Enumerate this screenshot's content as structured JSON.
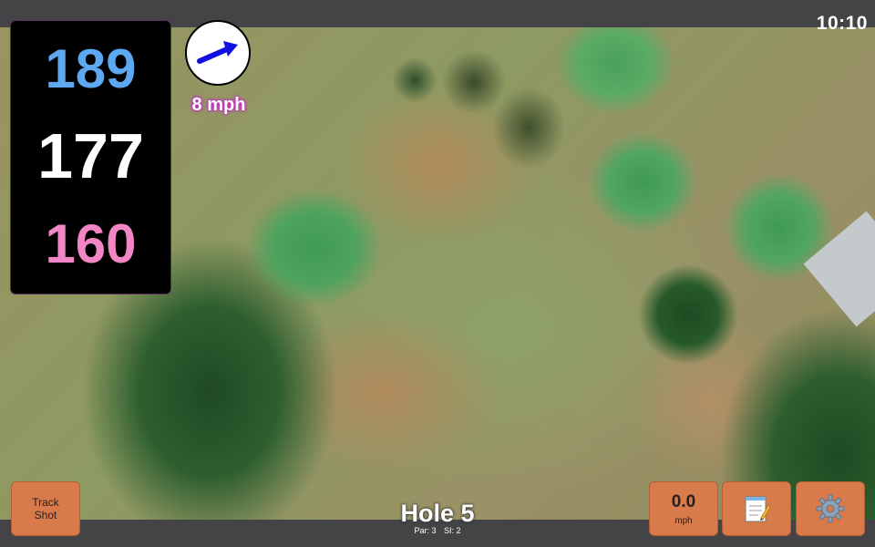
{
  "status": {
    "time": "10:10"
  },
  "distances": {
    "back": "189",
    "middle": "177",
    "front": "160"
  },
  "wind": {
    "speed": "8 mph",
    "icon": "arrow-icon"
  },
  "hole": {
    "title": "Hole 5",
    "par": "Par: 3",
    "stroke_index": "SI: 2"
  },
  "buttons": {
    "track_shot": "Track\nShot",
    "speed_value": "0.0",
    "speed_unit": "mph",
    "notes_icon": "notepad-icon",
    "settings_icon": "gear-icon"
  },
  "colors": {
    "back": "#5ea8f2",
    "middle": "#ffffff",
    "front": "#f285c4",
    "button": "#d97a4a",
    "bar": "#444446"
  }
}
